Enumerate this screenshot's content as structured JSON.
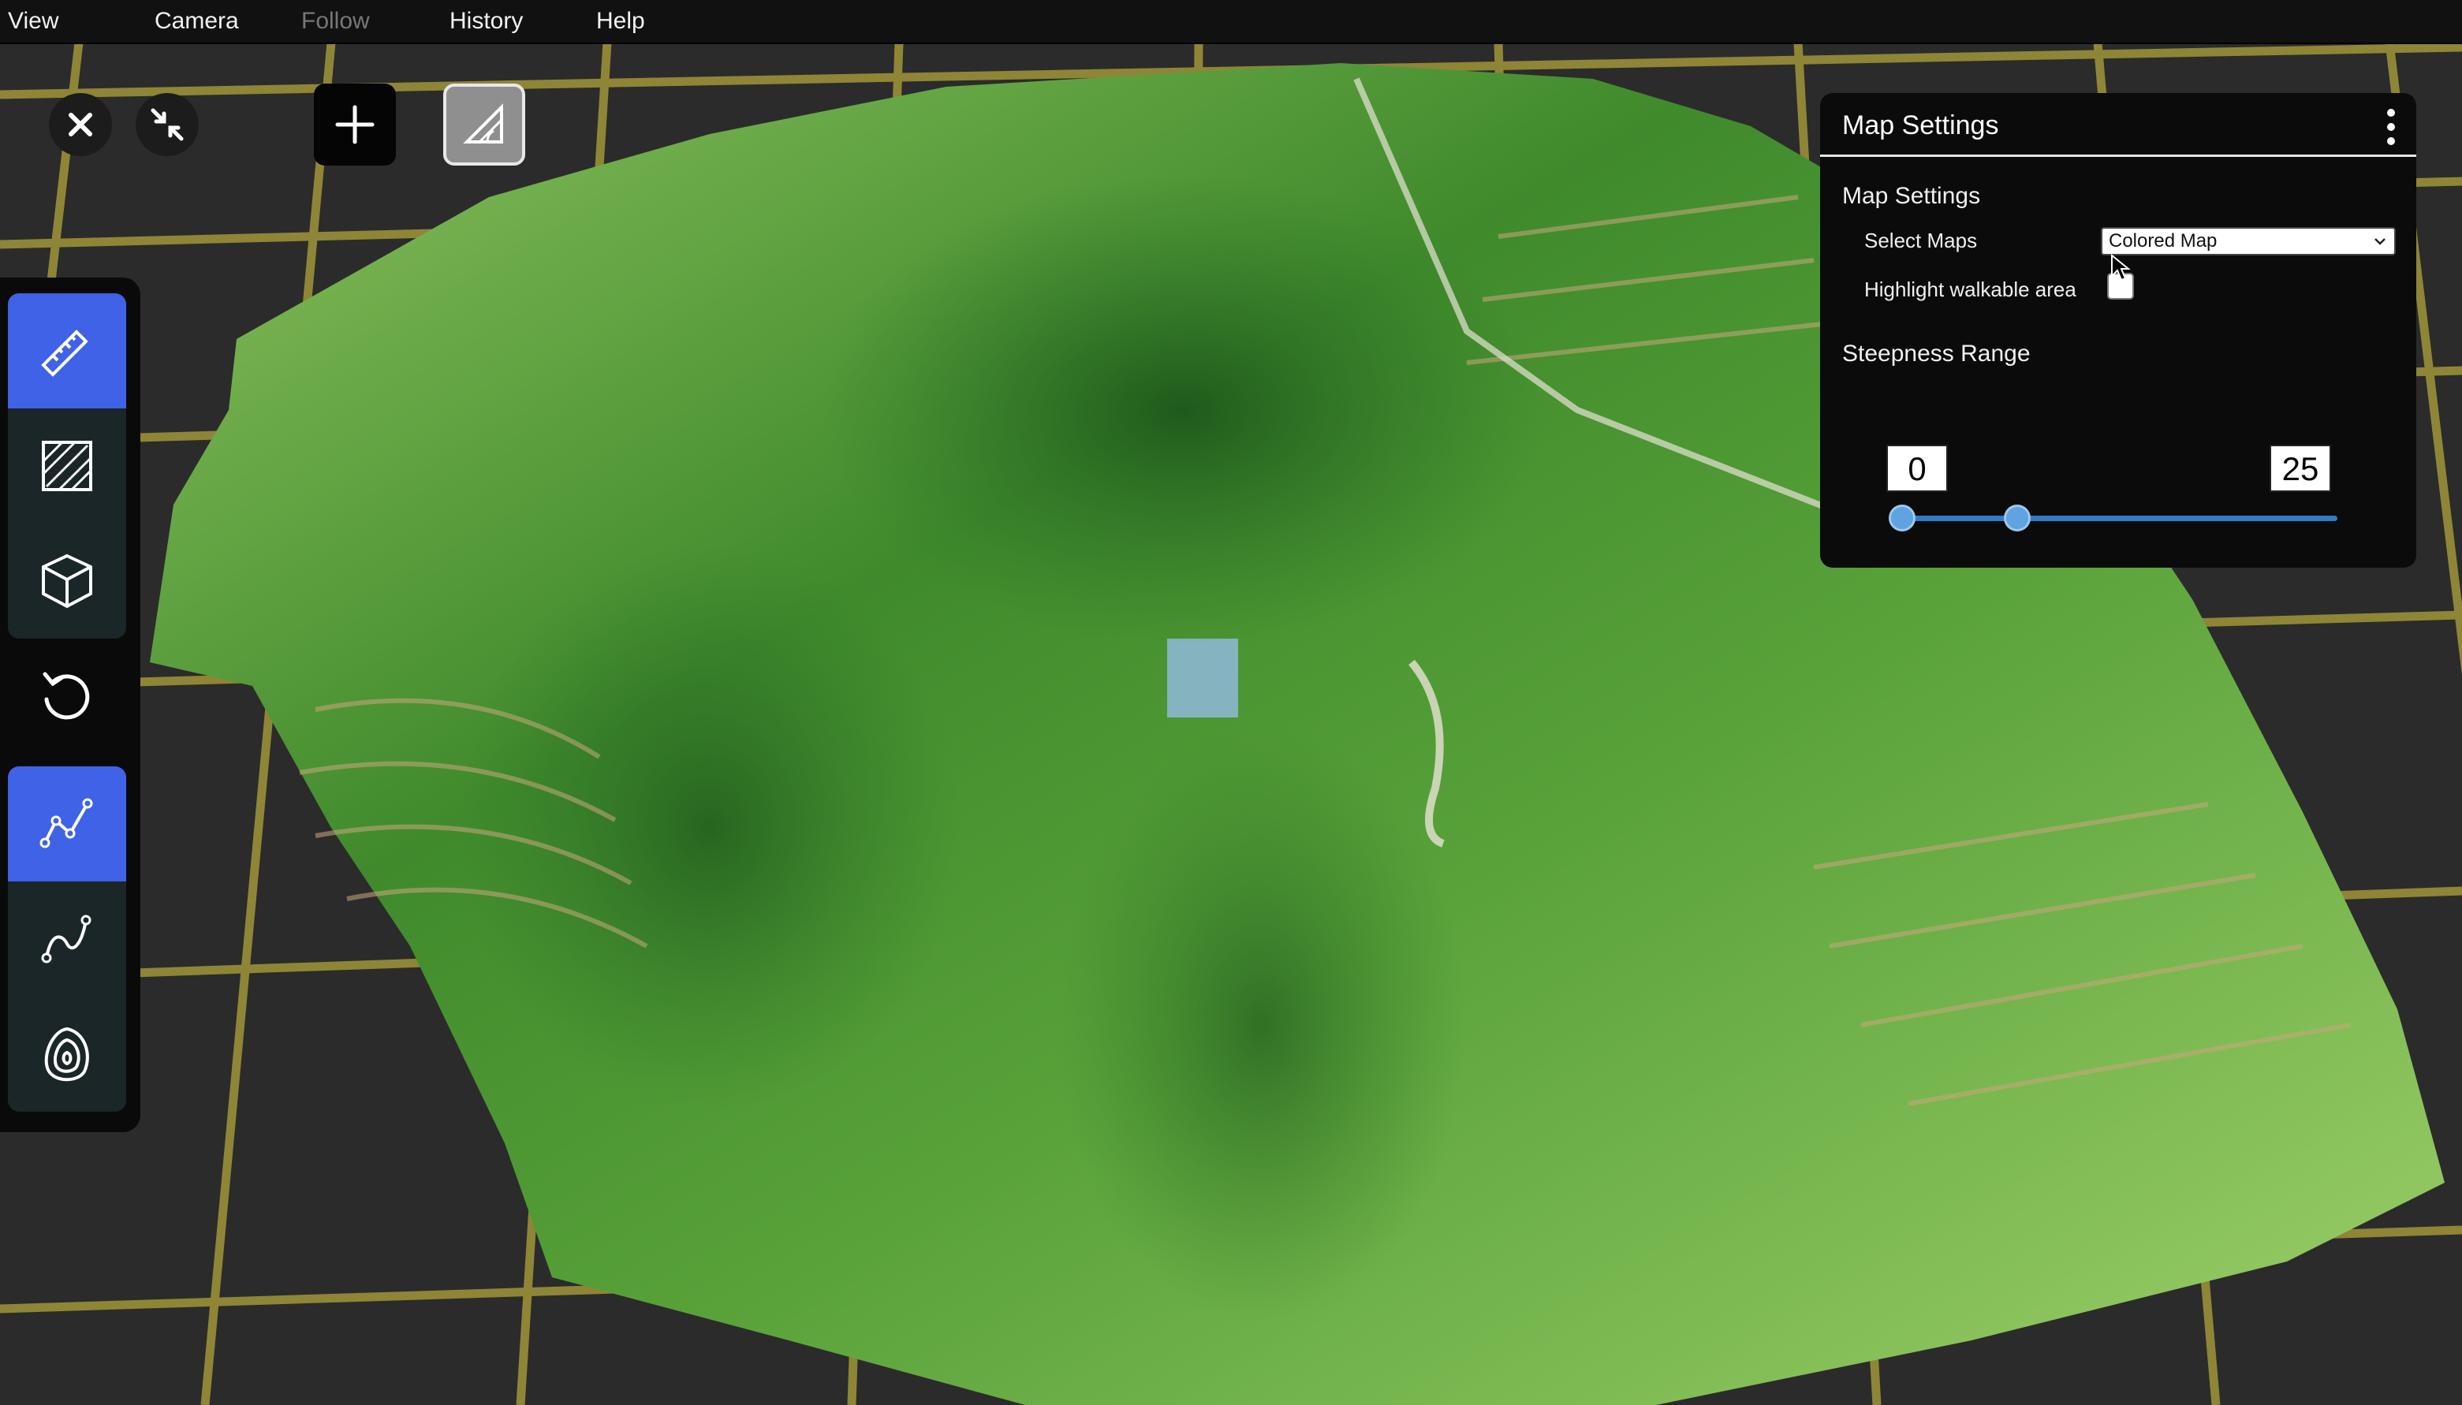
{
  "menubar": {
    "items": [
      {
        "label": "View",
        "enabled": true
      },
      {
        "label": "Camera",
        "enabled": true
      },
      {
        "label": "Follow",
        "enabled": false
      },
      {
        "label": "History",
        "enabled": true
      },
      {
        "label": "Help",
        "enabled": true
      }
    ]
  },
  "top_buttons": {
    "icons": [
      "close-icon",
      "minimize-icon",
      "plus-icon",
      "set-square-measure-icon"
    ]
  },
  "toolbar": {
    "tools": [
      {
        "icon": "ruler-icon",
        "active": true
      },
      {
        "icon": "hatched-area-icon",
        "active": false
      },
      {
        "icon": "cube-icon",
        "active": false
      },
      {
        "icon": "undo-rotate-icon",
        "active": false
      },
      {
        "icon": "polyline-path-icon",
        "active": true
      },
      {
        "icon": "curve-path-icon",
        "active": false
      },
      {
        "icon": "contour-icon",
        "active": false
      }
    ]
  },
  "panel": {
    "title": "Map Settings",
    "section_map": "Map Settings",
    "select_label": "Select Maps",
    "select_value": "Colored Map",
    "walk_label": "Highlight walkable area",
    "walk_checked": false,
    "steepness_title": "Steepness Range",
    "range_min": "0",
    "range_max": "25"
  },
  "colors": {
    "accent": "#3f62e6",
    "grid_line": "#8f8536",
    "slider": "#2f7bc4"
  }
}
